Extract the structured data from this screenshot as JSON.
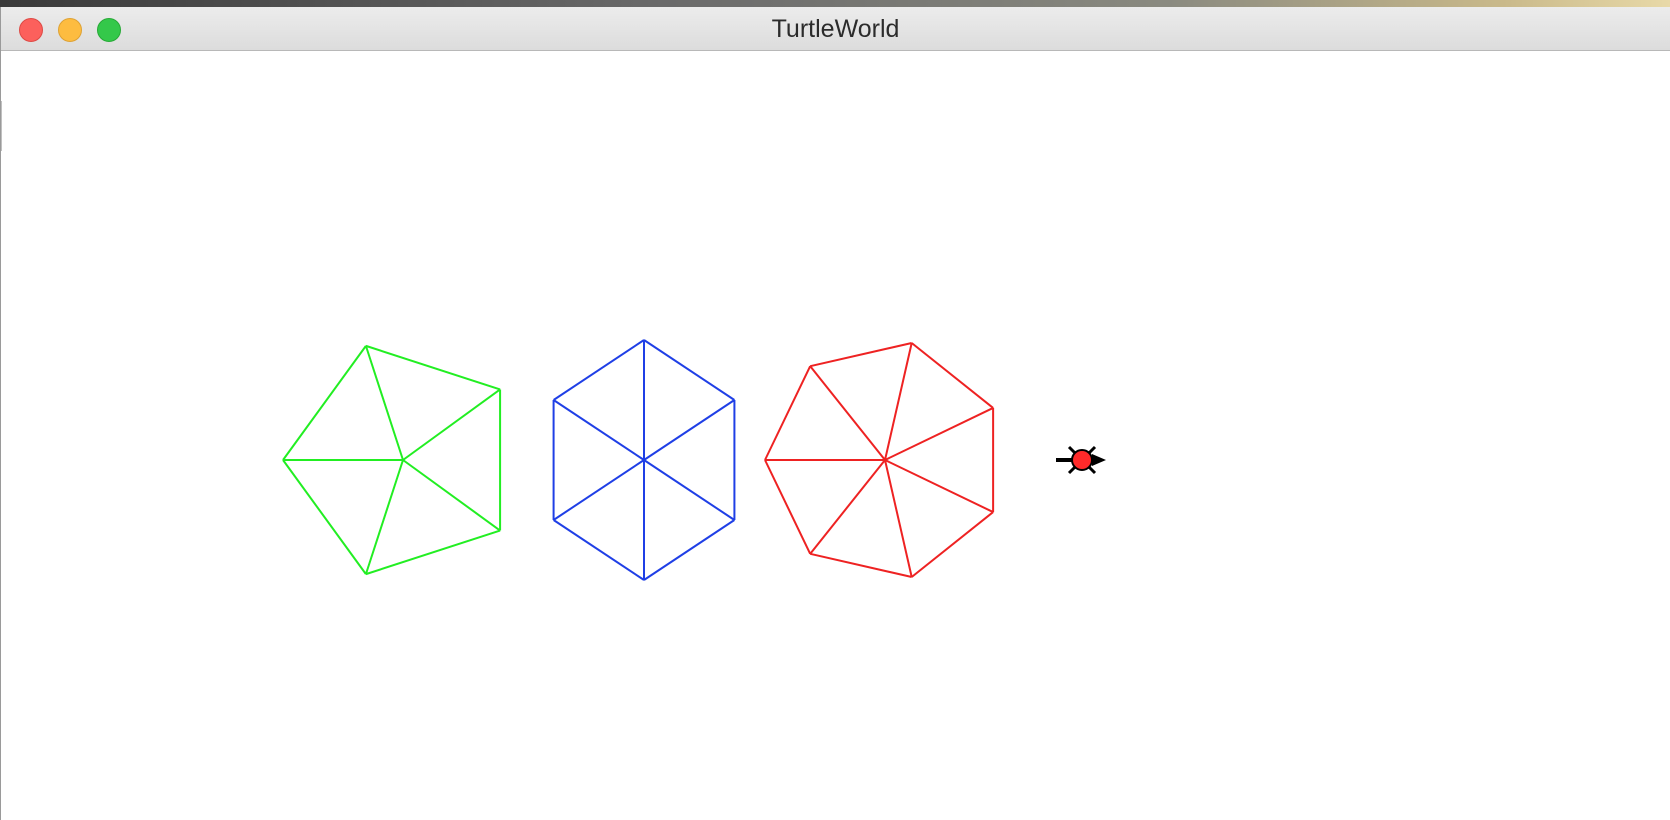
{
  "window": {
    "title": "TurtleWorld"
  },
  "titlebar": {
    "buttons": [
      {
        "name": "close",
        "color": "#fc605c"
      },
      {
        "name": "minimize",
        "color": "#fdbc40"
      },
      {
        "name": "zoom",
        "color": "#34c84a"
      }
    ]
  },
  "canvas": {
    "background": "#ffffff",
    "polygons": [
      {
        "name": "pentagon",
        "sides": 5,
        "color": "#22ee22"
      },
      {
        "name": "hexagon",
        "sides": 6,
        "color": "#1f3fe6"
      },
      {
        "name": "heptagon",
        "sides": 7,
        "color": "#ee2222"
      }
    ],
    "turtle": {
      "icon": "turtle-icon",
      "body_color": "#ff2a2a",
      "outline_color": "#000000",
      "heading": "east"
    }
  }
}
